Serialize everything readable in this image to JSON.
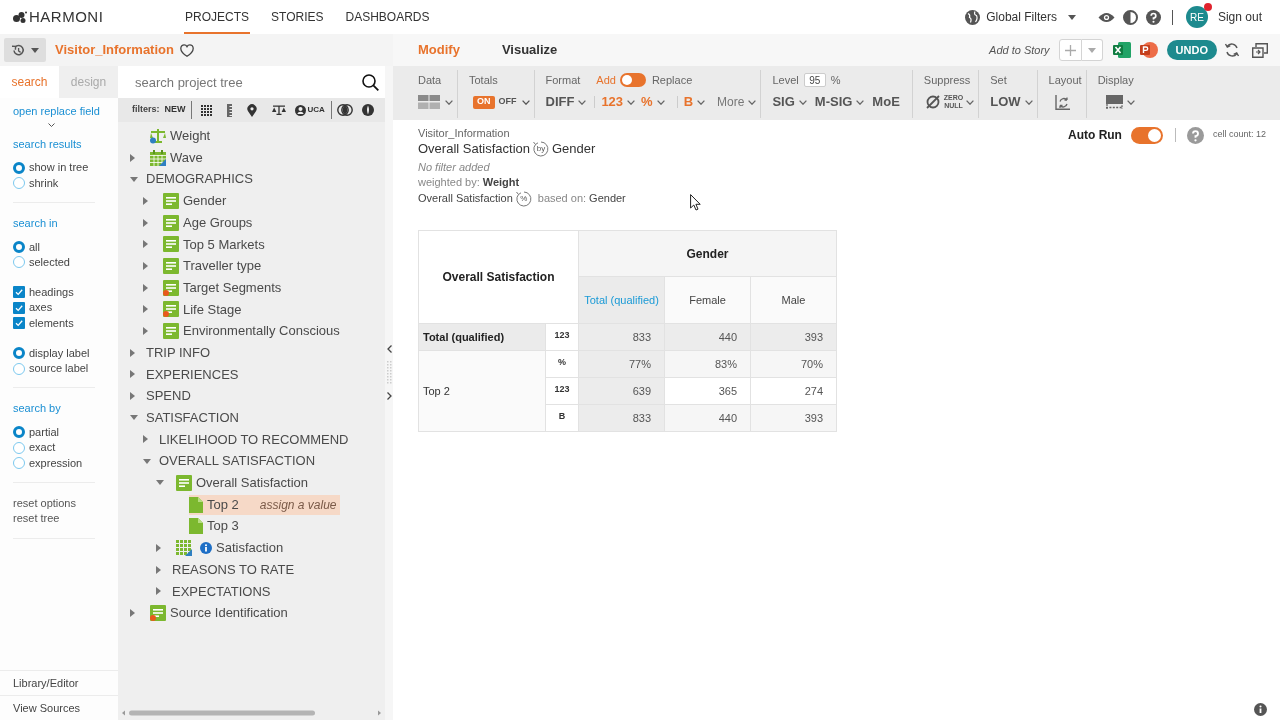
{
  "header": {
    "logo": "HARMONI",
    "nav": [
      {
        "label": "PROJECTS",
        "selected": true
      },
      {
        "label": "STORIES",
        "selected": false
      },
      {
        "label": "DASHBOARDS",
        "selected": false
      }
    ],
    "global_filters": "Global Filters",
    "user": {
      "initials": "RE",
      "notification": true
    },
    "sign_out": "Sign out"
  },
  "project": {
    "name": "Visitor_Information",
    "favorite": false
  },
  "view_tabs": [
    {
      "label": "Modify",
      "selected": true
    },
    {
      "label": "Visualize",
      "selected": false
    }
  ],
  "actions": {
    "add_to_story": "Add to Story",
    "undo": "UNDO"
  },
  "panel_tabs": [
    {
      "label": "search",
      "selected": true
    },
    {
      "label": "design",
      "selected": false
    }
  ],
  "tree_search": {
    "placeholder": "search project tree"
  },
  "filters": {
    "label": "filters:",
    "new": "NEW",
    "uca": "UCA"
  },
  "options": {
    "open_replace": "open replace field",
    "sections": [
      {
        "heading": "search results",
        "groups": [
          [
            {
              "kind": "radio",
              "label": "show in tree",
              "selected": true
            },
            {
              "kind": "radio",
              "label": "shrink",
              "selected": false
            }
          ]
        ]
      },
      {
        "heading": "search in",
        "groups": [
          [
            {
              "kind": "radio",
              "label": "all",
              "selected": true
            },
            {
              "kind": "radio",
              "label": "selected",
              "selected": false
            }
          ],
          [
            {
              "kind": "checkbox",
              "label": "headings",
              "checked": true
            },
            {
              "kind": "checkbox",
              "label": "axes",
              "checked": true
            },
            {
              "kind": "checkbox",
              "label": "elements",
              "checked": true
            }
          ],
          [
            {
              "kind": "radio",
              "label": "display label",
              "selected": true
            },
            {
              "kind": "radio",
              "label": "source label",
              "selected": false
            }
          ]
        ]
      },
      {
        "heading": "search by",
        "groups": [
          [
            {
              "kind": "radio",
              "label": "partial",
              "selected": true
            },
            {
              "kind": "radio",
              "label": "exact",
              "selected": false
            },
            {
              "kind": "radio",
              "label": "expression",
              "selected": false
            }
          ]
        ]
      }
    ],
    "links": [
      "reset options",
      "reset tree"
    ],
    "footer_links": [
      "Library/Editor",
      "View Sources"
    ]
  },
  "tree": [
    {
      "label": "Weight",
      "kind": "weight",
      "selected": false
    },
    {
      "label": "Wave",
      "kind": "date",
      "expanded": false,
      "selected": false
    },
    {
      "label": "DEMOGRAPHICS",
      "kind": "folder",
      "expanded": true,
      "selected": false,
      "children": [
        {
          "label": "Gender",
          "kind": "list",
          "expanded": false,
          "selected": false
        },
        {
          "label": "Age Groups",
          "kind": "list",
          "expanded": false,
          "selected": false
        },
        {
          "label": "Top 5 Markets",
          "kind": "list",
          "expanded": false,
          "selected": false
        },
        {
          "label": "Traveller type",
          "kind": "list",
          "expanded": false,
          "selected": false
        },
        {
          "label": "Target Segments",
          "kind": "flagged",
          "expanded": false,
          "selected": false
        },
        {
          "label": "Life Stage",
          "kind": "flagged",
          "expanded": false,
          "selected": false
        },
        {
          "label": "Environmentally Conscious",
          "kind": "list",
          "expanded": false,
          "selected": false
        }
      ]
    },
    {
      "label": "TRIP INFO",
      "kind": "folder",
      "expanded": false,
      "selected": false
    },
    {
      "label": "EXPERIENCES",
      "kind": "folder",
      "expanded": false,
      "selected": false
    },
    {
      "label": "SPEND",
      "kind": "folder",
      "expanded": false,
      "selected": false
    },
    {
      "label": "SATISFACTION",
      "kind": "folder",
      "expanded": true,
      "selected": false,
      "children": [
        {
          "label": "LIKELIHOOD TO RECOMMEND",
          "kind": "folder",
          "expanded": false,
          "selected": false
        },
        {
          "label": "OVERALL SATISFACTION",
          "kind": "folder",
          "expanded": true,
          "selected": false,
          "children": [
            {
              "label": "Overall Satisfaction",
              "kind": "list",
              "expanded": true,
              "selected": false,
              "children": [
                {
                  "label": "Top 2",
                  "kind": "code",
                  "selected": true,
                  "hint": "assign a value"
                },
                {
                  "label": "Top 3",
                  "kind": "code",
                  "selected": false
                }
              ]
            },
            {
              "label": "Satisfaction",
              "kind": "grid",
              "expanded": false,
              "selected": false
            },
            {
              "label": "REASONS TO RATE",
              "kind": "folder",
              "expanded": false,
              "selected": false
            },
            {
              "label": "EXPECTATIONS",
              "kind": "folder",
              "expanded": false,
              "selected": false
            }
          ]
        }
      ]
    },
    {
      "label": "Source Identification",
      "kind": "flagged",
      "expanded": false,
      "selected": false
    }
  ],
  "toolbar": {
    "data": {
      "label": "Data"
    },
    "totals": {
      "label": "Totals",
      "on_text": "ON",
      "off_text": "OFF",
      "on": true
    },
    "format": {
      "label": "Format",
      "add": "Add",
      "replace": "Replace",
      "replace_on": false,
      "options": [
        {
          "text": "DIFF",
          "kind": "option",
          "active": false,
          "divider_before": false
        },
        {
          "text": "123",
          "kind": "option",
          "active": true,
          "divider_before": true
        },
        {
          "text": "%",
          "kind": "option",
          "active": true,
          "divider_before": false
        },
        {
          "text": "B",
          "kind": "option",
          "active": true,
          "divider_before": true
        },
        {
          "text": "More",
          "kind": "menu",
          "active": false,
          "divider_before": false
        }
      ]
    },
    "level": {
      "label": "Level",
      "value": "95",
      "unit": "%",
      "options": [
        {
          "text": "SIG",
          "dropdown": true
        },
        {
          "text": "M-SIG",
          "dropdown": true
        },
        {
          "text": "MoE",
          "dropdown": false
        }
      ]
    },
    "suppress": {
      "label": "Suppress",
      "lines": [
        "ZERO",
        "NULL"
      ]
    },
    "set": {
      "label": "Set",
      "value": "LOW"
    },
    "layout": {
      "label": "Layout"
    },
    "display": {
      "label": "Display"
    }
  },
  "report": {
    "path": "Visitor_Information",
    "row_variable": "Overall Satisfaction",
    "cross_mark": "by",
    "column_variable": "Gender",
    "filter_note": "No filter added",
    "weighted_label": "weighted by:",
    "weight": "Weight",
    "percent_variable": "Overall Satisfaction",
    "percent_mark": "%",
    "based_on_label": "based on:",
    "based_on": "Gender",
    "auto_run": {
      "label": "Auto Run",
      "on": true
    },
    "cell_count": "cell count: 12"
  },
  "table": {
    "corner": "Overall Satisfaction",
    "banner": "Gender",
    "columns": [
      {
        "label": "Total (qualified)",
        "kind": "total"
      },
      {
        "label": "Female",
        "kind": "category"
      },
      {
        "label": "Male",
        "kind": "category"
      }
    ],
    "rows": [
      {
        "label": "Total (qualified)",
        "kind": "total",
        "stats": [
          {
            "code": "123",
            "values": [
              "833",
              "440",
              "393"
            ]
          }
        ]
      },
      {
        "label": "Top 2",
        "kind": "category",
        "stats": [
          {
            "code": "%",
            "values": [
              "77%",
              "83%",
              "70%"
            ]
          },
          {
            "code": "123",
            "values": [
              "639",
              "365",
              "274"
            ]
          },
          {
            "code": "B",
            "values": [
              "833",
              "440",
              "393"
            ]
          }
        ]
      }
    ]
  }
}
